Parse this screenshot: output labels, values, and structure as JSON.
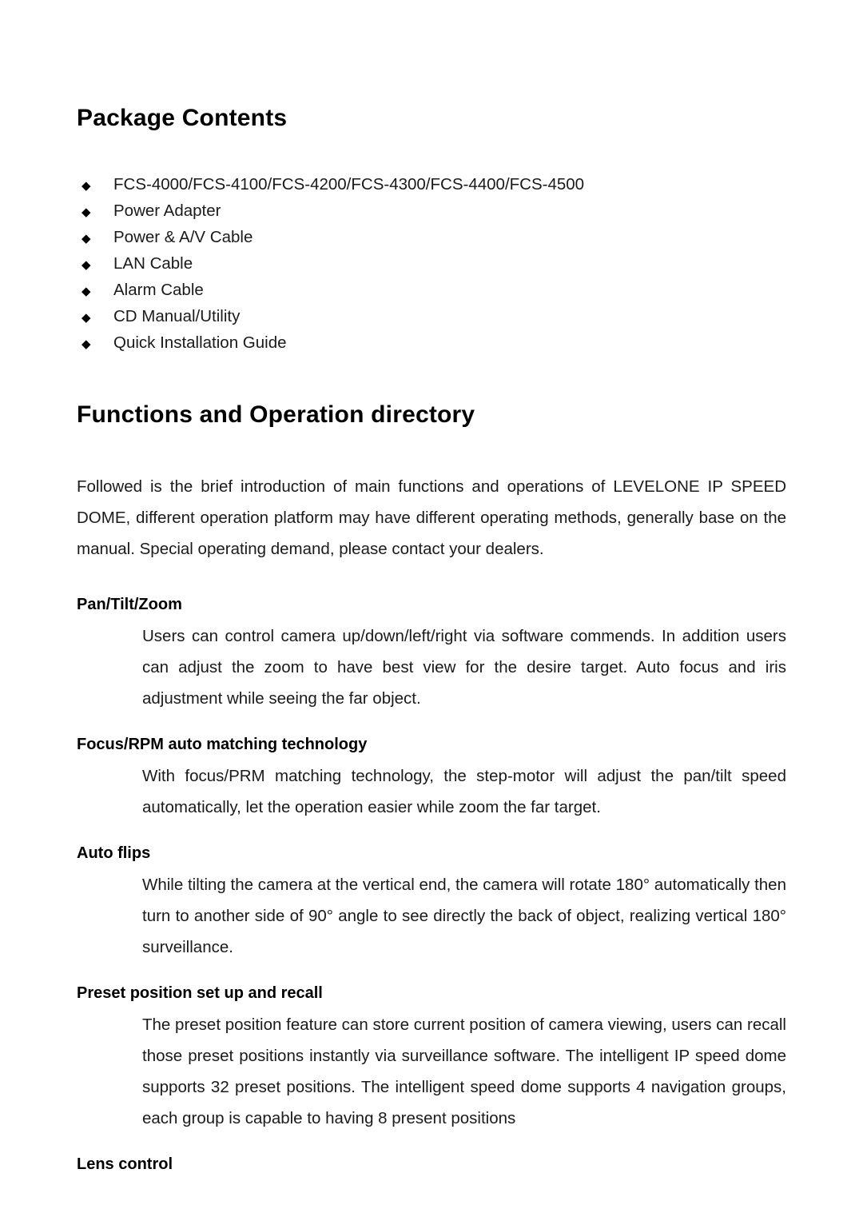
{
  "document": {
    "package_contents": {
      "heading": "Package Contents",
      "items": [
        "FCS-4000/FCS-4100/FCS-4200/FCS-4300/FCS-4400/FCS-4500",
        "Power Adapter",
        "Power & A/V Cable",
        "LAN Cable",
        "Alarm Cable",
        "CD Manual/Utility",
        "Quick Installation Guide"
      ],
      "bullet_glyph": "◆"
    },
    "functions_section": {
      "heading": "Functions and Operation directory",
      "intro": "Followed is the brief introduction of main functions and operations of LEVELONE IP SPEED DOME, different operation platform may have different operating methods, generally base on the manual. Special operating demand, please contact your dealers.",
      "features": [
        {
          "title": "Pan/Tilt/Zoom",
          "body": "Users can control camera up/down/left/right via software commends. In addition users can adjust the zoom to have best view for the desire target. Auto focus and iris adjustment while seeing the far object."
        },
        {
          "title": "Focus/RPM auto matching technology",
          "body": "With focus/PRM matching technology, the step-motor will adjust the pan/tilt speed automatically, let the operation easier while zoom the far target."
        },
        {
          "title": "Auto flips",
          "body": "While tilting the camera at the vertical end, the camera will rotate 180° automatically then turn to another side of 90° angle to see directly the back of object, realizing vertical 180° surveillance."
        },
        {
          "title": "Preset position set up and recall",
          "body": "The preset position feature can store current position of camera viewing, users can recall those preset positions instantly via surveillance software. The intelligent IP speed dome supports 32 preset positions. The intelligent speed dome supports 4 navigation groups, each group is capable to having 8 present positions"
        },
        {
          "title": "Lens control",
          "body": ""
        }
      ]
    }
  }
}
